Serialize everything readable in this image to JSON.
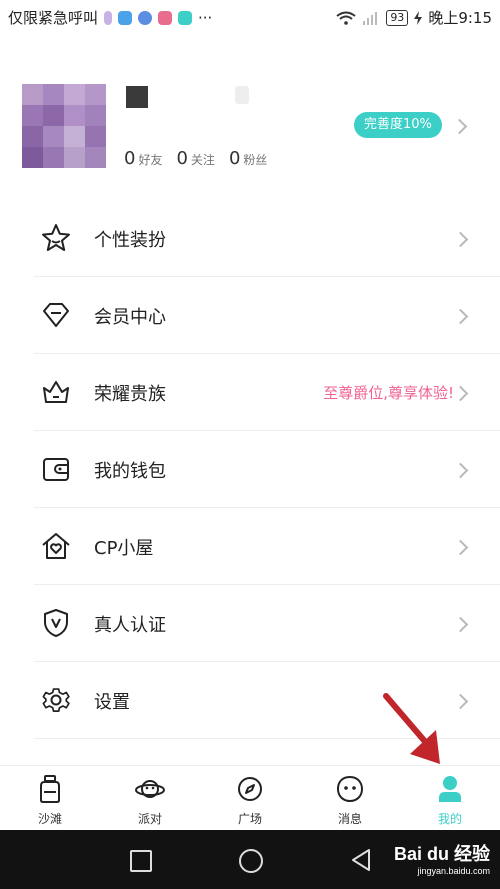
{
  "status_bar": {
    "carrier": "仅限紧急呼叫",
    "dots": "···",
    "battery": "93",
    "time": "晚上9:15"
  },
  "profile": {
    "stats": [
      {
        "num": "0",
        "label": "好友"
      },
      {
        "num": "0",
        "label": "关注"
      },
      {
        "num": "0",
        "label": "粉丝"
      }
    ],
    "completion_badge": "完善度10%"
  },
  "menu": [
    {
      "label": "个性装扮",
      "icon": "star-icon"
    },
    {
      "label": "会员中心",
      "icon": "diamond-icon"
    },
    {
      "label": "荣耀贵族",
      "icon": "crown-icon",
      "extra": "至尊爵位,尊享体验!"
    },
    {
      "label": "我的钱包",
      "icon": "wallet-icon"
    },
    {
      "label": "CP小屋",
      "icon": "house-heart-icon"
    },
    {
      "label": "真人认证",
      "icon": "shield-v-icon"
    },
    {
      "label": "设置",
      "icon": "gear-icon"
    }
  ],
  "tabs": [
    {
      "label": "沙滩",
      "icon": "bottle-icon"
    },
    {
      "label": "派对",
      "icon": "planet-icon"
    },
    {
      "label": "广场",
      "icon": "compass-icon"
    },
    {
      "label": "消息",
      "icon": "face-icon"
    },
    {
      "label": "我的",
      "icon": "person-icon",
      "active": true
    }
  ],
  "colors": {
    "accent": "#3bcfc7",
    "highlight": "#f06292",
    "annotation_arrow": "#c0262a"
  },
  "watermark": {
    "brand": "Bai du 经验",
    "url": "jingyan.baidu.com"
  }
}
